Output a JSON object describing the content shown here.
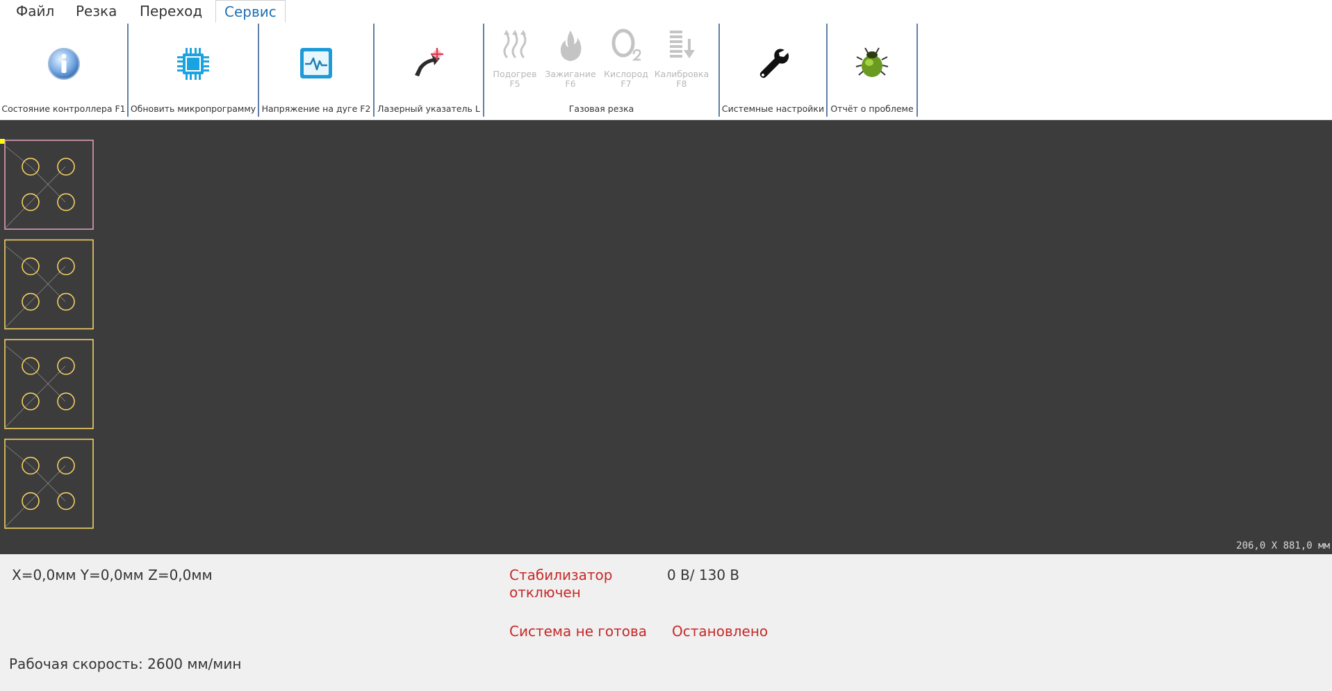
{
  "menu": {
    "items": [
      "Файл",
      "Резка",
      "Переход",
      "Сервис"
    ],
    "active": "Сервис"
  },
  "ribbon": {
    "controller_status": "Состояние контроллера F1",
    "update_firmware": "Обновить микропрограмму",
    "arc_voltage": "Напряжение на дуге F2",
    "laser_pointer": "Лазерный указатель L",
    "gas_group": {
      "label": "Газовая резка",
      "buttons": [
        {
          "label": "Подогрев",
          "key": "F5"
        },
        {
          "label": "Зажигание",
          "key": "F6"
        },
        {
          "label": "Кислород",
          "key": "F7"
        },
        {
          "label": "Калибровка",
          "key": "F8"
        }
      ]
    },
    "system_settings": "Системные настройки",
    "problem_report": "Отчёт о проблеме"
  },
  "canvas": {
    "dimensions": "206,0 X 881,0 мм",
    "part_count": 4
  },
  "status": {
    "coords": "X=0,0мм  Y=0,0мм  Z=0,0мм",
    "stabilizer_line1": "Стабилизатор",
    "stabilizer_line2": "отключен",
    "voltage": "0 В/ 130 В",
    "system": "Система не готова",
    "state": "Остановлено",
    "speed": "Рабочая скорость: 2600 мм/мин"
  },
  "colors": {
    "accent": "#1f6fb2",
    "canvas_bg": "#3c3c3c",
    "part_outline": "#ffd966",
    "warning": "#c62828"
  }
}
